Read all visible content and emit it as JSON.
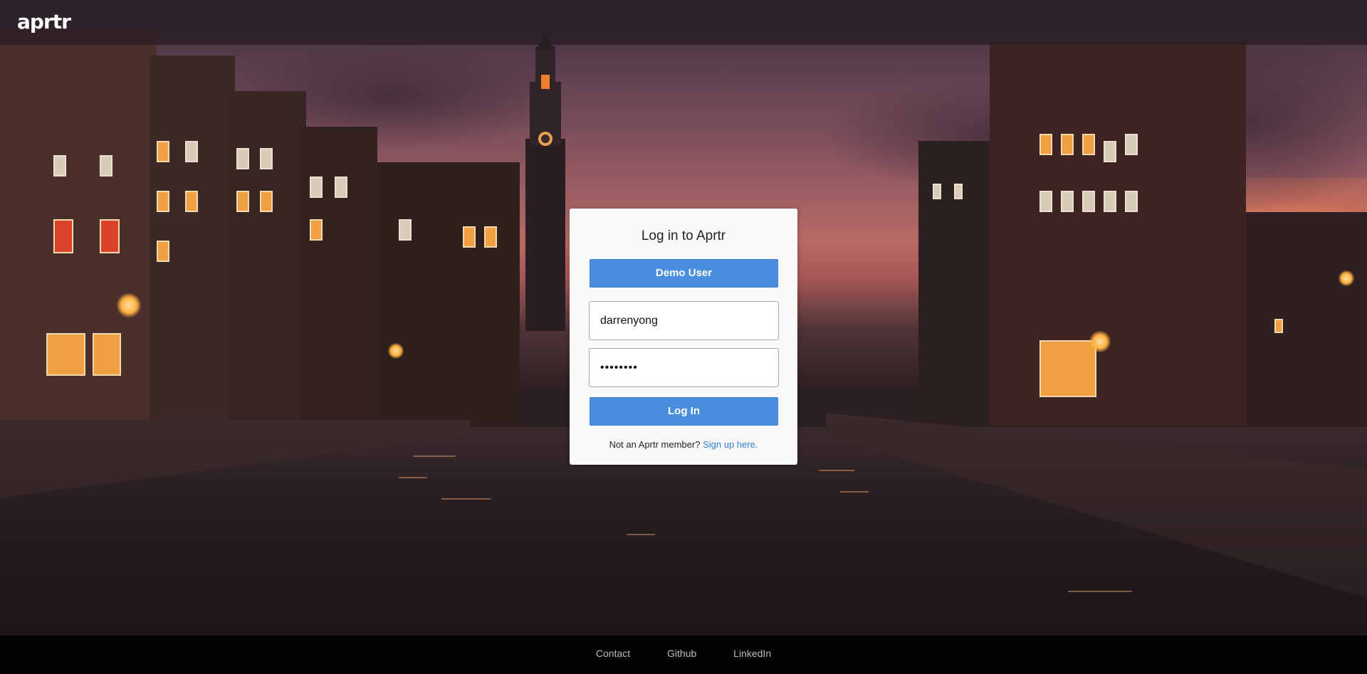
{
  "header": {
    "logo_text": "aprtr"
  },
  "login": {
    "title": "Log in to Aprtr",
    "demo_button_label": "Demo User",
    "username_value": "darrenyong",
    "password_value": "••••••••",
    "login_button_label": "Log In",
    "signup_prompt": "Not an Aprtr member?",
    "signup_link_label": "Sign up here."
  },
  "footer": {
    "links": [
      "Contact",
      "Github",
      "LinkedIn"
    ]
  },
  "background": {
    "description_icon": "amsterdam-canal-sunset-photo"
  },
  "colors": {
    "accent": "#4a8fdf",
    "link": "#2f7fd1",
    "header_bg": "#281e24",
    "footer_bg": "#030303"
  }
}
